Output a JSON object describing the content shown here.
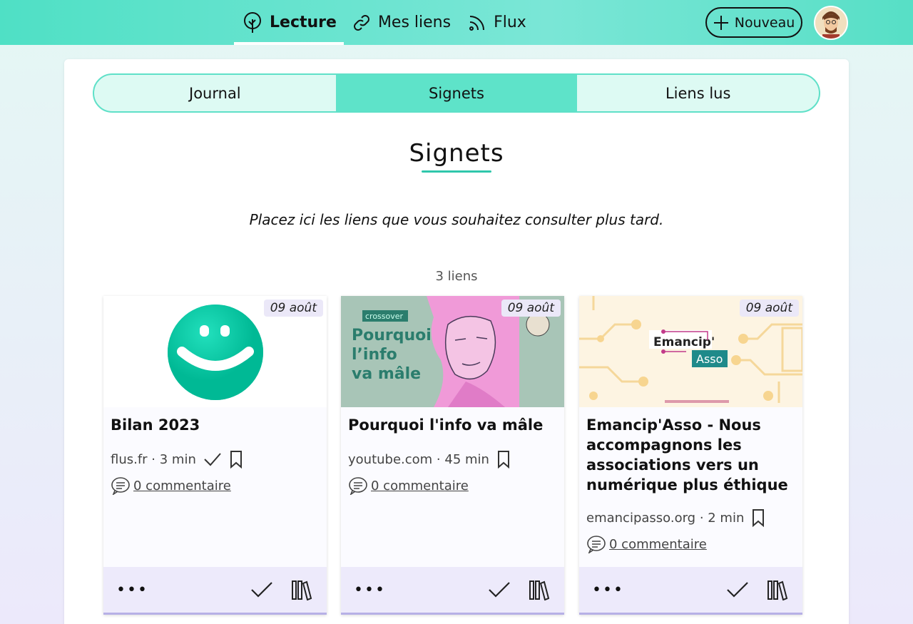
{
  "nav": {
    "items": [
      {
        "label": "Lecture",
        "icon": "tree-icon",
        "active": true
      },
      {
        "label": "Mes liens",
        "icon": "link-icon",
        "active": false
      },
      {
        "label": "Flux",
        "icon": "rss-icon",
        "active": false
      }
    ],
    "new_button": "Nouveau"
  },
  "tabs": [
    {
      "label": "Journal",
      "active": false
    },
    {
      "label": "Signets",
      "active": true
    },
    {
      "label": "Liens lus",
      "active": false
    }
  ],
  "page": {
    "title": "Signets",
    "subtitle": "Placez ici les liens que vous souhaitez consulter plus tard.",
    "count": "3 liens"
  },
  "cards": [
    {
      "date": "09 août",
      "title": "Bilan 2023",
      "meta": "flus.fr · 3 min",
      "comments": "0 commentaire",
      "image": "flus-smiley-logo"
    },
    {
      "date": "09 août",
      "title": "Pourquoi l'info va mâle",
      "meta": "youtube.com · 45 min",
      "comments": "0 commentaire",
      "image": "crossover-thumbnail",
      "image_text": {
        "tag": "crossover",
        "line1": "Pourquoi",
        "line2": "l’info",
        "line3": "va mâle"
      }
    },
    {
      "date": "09 août",
      "title": "Emancip'Asso - Nous accompagnons les associations vers un numérique plus éthique",
      "meta": "emancipasso.org · 2 min",
      "comments": "0 commentaire",
      "image": "emancipasso-logo",
      "image_text": {
        "word1": "Emancip'",
        "word2": "Asso"
      }
    }
  ],
  "colors": {
    "accent": "#5ee3c9",
    "footer": "#edeafb"
  }
}
